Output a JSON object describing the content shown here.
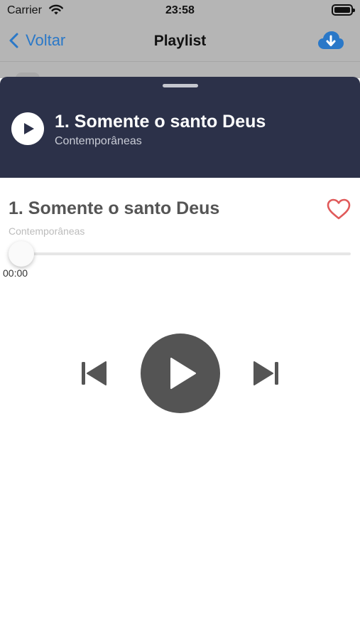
{
  "status_bar": {
    "carrier": "Carrier",
    "time": "23:58",
    "wifi_icon": "wifi-icon",
    "battery_icon": "battery-icon"
  },
  "nav": {
    "back_label": "Voltar",
    "title": "Playlist",
    "download_icon": "cloud-download-icon",
    "accent_color": "#2a78c8"
  },
  "mini_player": {
    "title": "1. Somente o santo Deus",
    "subtitle": "Contemporâneas",
    "play_icon": "play-icon",
    "background_color": "#2c3149"
  },
  "player": {
    "title": "1. Somente o santo Deus",
    "subtitle": "Contemporâneas",
    "favorite_icon": "heart-outline-icon",
    "favorite_color": "#e05a5a",
    "progress_fraction": 0,
    "elapsed_time": "00:00",
    "controls": {
      "previous_icon": "skip-previous-icon",
      "play_icon": "play-icon",
      "next_icon": "skip-next-icon"
    }
  }
}
